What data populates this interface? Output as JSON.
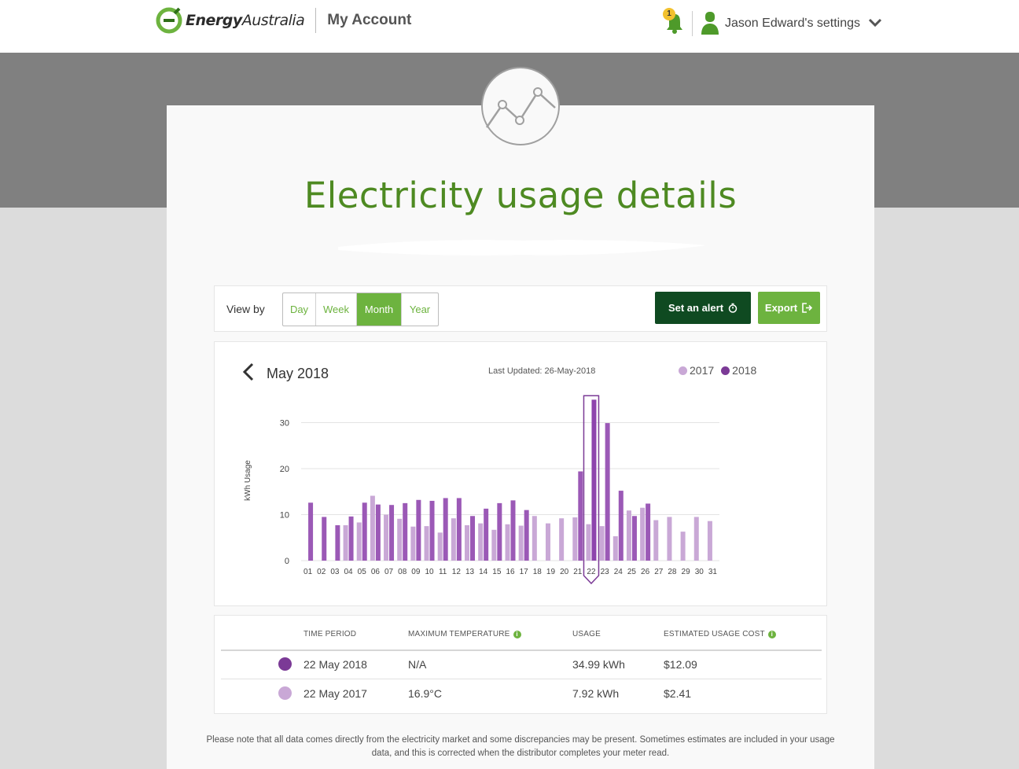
{
  "header": {
    "brand_bold": "Energy",
    "brand_light": "Australia",
    "section": "My Account",
    "notification_count": "1",
    "user_menu_label": "Jason Edward's settings"
  },
  "page": {
    "title": "Electricity usage details"
  },
  "view_bar": {
    "label": "View by",
    "options": [
      "Day",
      "Week",
      "Month",
      "Year"
    ],
    "selected": "Month",
    "alert_button": "Set an alert",
    "export_button": "Export"
  },
  "chart_panel": {
    "period": "May 2018",
    "last_updated": "Last Updated: 26-May-2018"
  },
  "chart_data": {
    "type": "bar",
    "categories": [
      "01",
      "02",
      "03",
      "04",
      "05",
      "06",
      "07",
      "08",
      "09",
      "10",
      "11",
      "12",
      "13",
      "14",
      "15",
      "16",
      "17",
      "18",
      "19",
      "20",
      "21",
      "22",
      "23",
      "24",
      "25",
      "26",
      "27",
      "28",
      "29",
      "30",
      "31"
    ],
    "series": [
      {
        "name": "2017",
        "color": "#c9a8d6",
        "values": [
          0,
          0,
          0,
          7.7,
          8.3,
          14.1,
          10.0,
          9.1,
          7.4,
          7.5,
          6.1,
          9.2,
          7.7,
          8.1,
          6.7,
          7.9,
          7.6,
          9.7,
          8.1,
          9.2,
          9.4,
          7.92,
          7.5,
          5.3,
          10.9,
          11.5,
          8.8,
          9.5,
          6.3,
          9.5,
          8.6
        ]
      },
      {
        "name": "2018",
        "color": "#9b59b6",
        "values": [
          12.6,
          9.5,
          7.7,
          9.6,
          12.6,
          12.2,
          12.1,
          12.5,
          13.2,
          13.0,
          13.6,
          13.6,
          9.7,
          11.3,
          12.5,
          13.1,
          11.0,
          null,
          null,
          null,
          19.4,
          34.99,
          29.9,
          15.2,
          9.7,
          12.4,
          null,
          null,
          null,
          null,
          null
        ]
      }
    ],
    "selected_category": "22",
    "xlabel": "",
    "ylabel": "kWh Usage",
    "ylim": [
      0,
      35
    ],
    "yticks": [
      0,
      10,
      20,
      30
    ],
    "grid": true,
    "legend_position": "top-right"
  },
  "usage_table": {
    "headers": {
      "period": "TIME PERIOD",
      "max_temp": "MAXIMUM TEMPERATURE",
      "usage": "USAGE",
      "cost": "ESTIMATED USAGE COST"
    },
    "rows": [
      {
        "period": "22 May 2018",
        "max_temp": "N/A",
        "usage": "34.99 kWh",
        "cost": "$12.09",
        "color": "#7b3a96"
      },
      {
        "period": "22 May 2017",
        "max_temp": "16.9°C",
        "usage": "7.92 kWh",
        "cost": "$2.41",
        "color": "#c9a8d6"
      }
    ]
  },
  "footnote": "Please note that all data comes directly from the electricity market and some discrepancies may be present. Sometimes estimates are included in your usage data, and this is corrected when the distributor completes your meter read."
}
